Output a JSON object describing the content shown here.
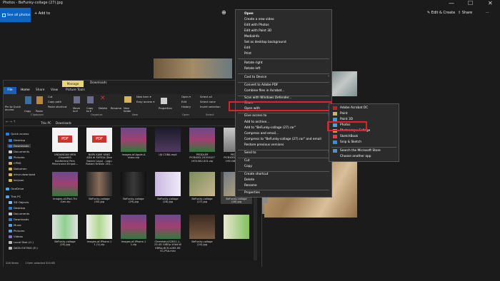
{
  "window": {
    "title": "Photos - BeFunky-collage (27).jpg",
    "ctrl_min": "—",
    "ctrl_max": "☐",
    "ctrl_close": "✕"
  },
  "toolbar": {
    "see_all": "See all photos",
    "add": "Add to",
    "zoom_in": "⊕",
    "edit_create": "Edit & Create",
    "share": "Share",
    "more": "···"
  },
  "explorer": {
    "title_tabs": [
      "Manage",
      "Downloads"
    ],
    "tabs": [
      "File",
      "Home",
      "Share",
      "View",
      "Picture Tools"
    ],
    "ribbon": {
      "pin": "Pin to Quick\naccess",
      "copy": "Copy",
      "paste": "Paste",
      "cut": "Cut",
      "copy_path": "Copy path",
      "paste_shortcut": "Paste shortcut",
      "move_to": "Move\nto ▾",
      "copy_to": "Copy\nto ▾",
      "delete": "Delete",
      "rename": "Rename",
      "new_folder": "New\nfolder",
      "new_item": "New item ▾",
      "easy_access": "Easy access ▾",
      "properties": "Properties",
      "open": "Open ▾",
      "edit": "Edit",
      "history": "History",
      "select_all": "Select all",
      "select_none": "Select none",
      "invert": "Invert selection"
    },
    "groups": [
      "Clipboard",
      "Organize",
      "New",
      "Open",
      "Select"
    ],
    "address": [
      "This PC",
      "Downloads"
    ],
    "sidebar": [
      "Quick access",
      "Desktop",
      "Downloads",
      "Documents",
      "Pictures",
      "CPNS",
      "Dokumen",
      "drive-download",
      "kerjaan",
      "OneDrive",
      "This PC",
      "3D Objects",
      "Desktop",
      "Documents",
      "Downloads",
      "Music",
      "Pictures",
      "Videos",
      "Local Disk (C:)",
      "DATA EXTING (E:)"
    ],
    "files": [
      {
        "name": "UNDANGAN MEN\n-EmpatKiS-\nKonferensi Pers\nPeluncuran Empat..."
      },
      {
        "name": "BAPA KAMI YANG\nADA di SURGA (Doa\nDalam Lagu) - Lagu\nRohani Kristen 201..."
      },
      {
        "name": "images-of-Apple-A\nntara.zip"
      },
      {
        "name": "UJI COBA.mp4"
      },
      {
        "name": "PEDDLER\nPICBXXD-20190107\n1951582-001.zip"
      },
      {
        "name": "PEDDLER\nPICBXXD-20190107\n1951582-001.jpg"
      },
      {
        "name": "images-of-iPad-7th\n-Gen.zip"
      },
      {
        "name": "BeFunky-collage\n(30).jpg"
      },
      {
        "name": "BeFunky-collage\n(29).jpg"
      },
      {
        "name": "BeFunky-collage\n(28).jpg"
      },
      {
        "name": "BeFunky-collage\n(27).jpg"
      },
      {
        "name": "BeFunky-collage\n(26).jpg"
      },
      {
        "name": "BeFunky-collage\n(25).jpg"
      },
      {
        "name": "images-of-iPhone-1\n1 (1).zip"
      },
      {
        "name": "images-of-iPhone-1\n1.zip"
      },
      {
        "name": "Chemistry(S2E01.1..\n23.45.1080p.10bit.W\nEBRip.6CH.x265.HE\nVC-PSA.mkv"
      },
      {
        "name": "BeFunky-collage\n(24).jpg"
      }
    ],
    "status": [
      "226 items",
      "1 item selected  520 KB"
    ]
  },
  "context_menu": {
    "items": [
      "Open",
      "Create a new video",
      "Edit with Photos",
      "Edit with Paint 3D",
      "MediaInfo",
      "Set as desktop background",
      "Edit",
      "Print",
      "Rotate right",
      "Rotate left",
      "Cast to Device",
      "Convert to Adobe PDF",
      "Combine files in Acrobat...",
      "Scan with Windows Defender...",
      "Share",
      "Open with",
      "Give access to",
      "Add to archive...",
      "Add to \"BeFunky-collage (27).rar\"",
      "Compress and email...",
      "Compress to \"BeFunky-collage (27).rar\" and email",
      "Restore previous versions",
      "Send to",
      "Cut",
      "Copy",
      "Create shortcut",
      "Delete",
      "Rename",
      "Properties"
    ]
  },
  "submenu": {
    "items": [
      "Adobe Acrobat DC",
      "Paint",
      "Paint 3D",
      "Photos",
      "Photoscape Collage",
      "SketchBook",
      "Snip & Sketch",
      "Search the Microsoft Store",
      "Choose another app"
    ]
  },
  "colors": {
    "accent": "#0a66c2",
    "highlight": "#e0202a",
    "manage_tab": "#e8d67a"
  }
}
